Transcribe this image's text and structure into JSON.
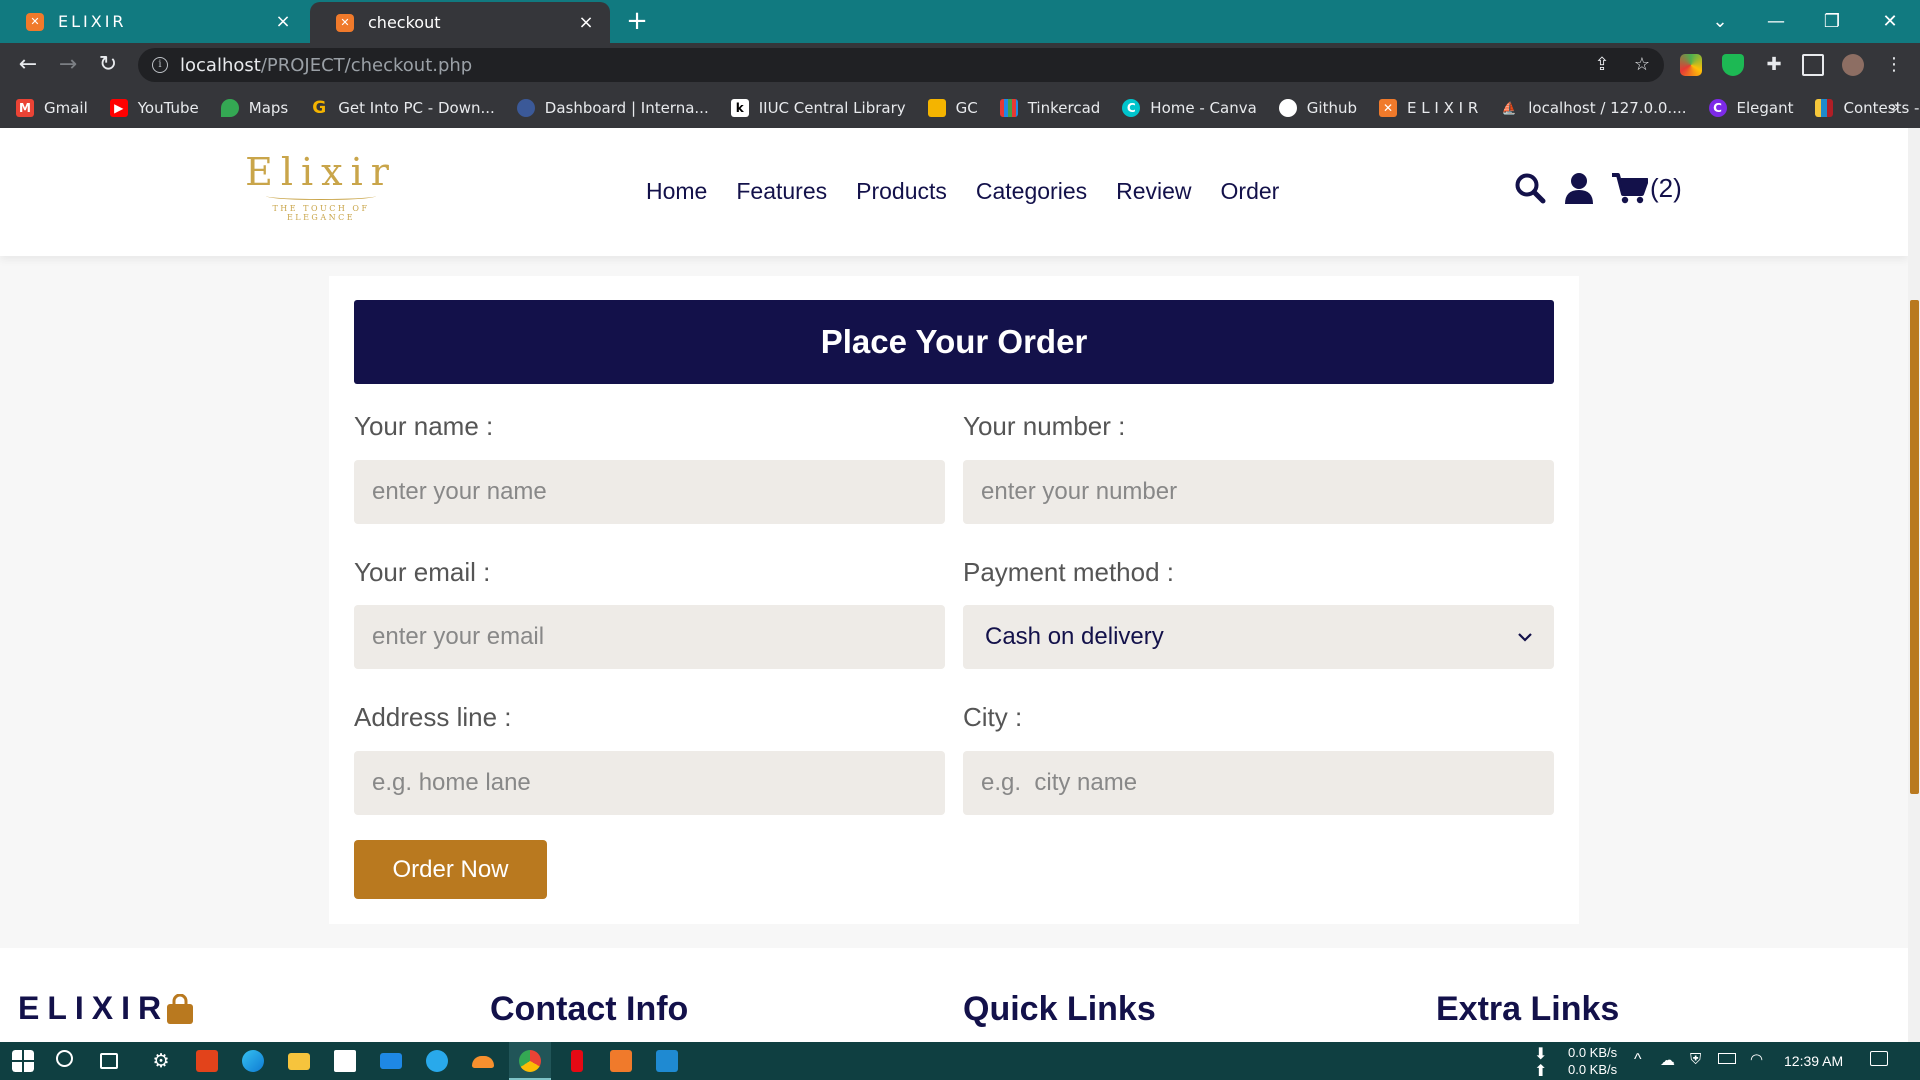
{
  "browser": {
    "tabs": [
      {
        "title": "ELIXIR",
        "favicon": "xampp-icon",
        "active": false
      },
      {
        "title": "checkout",
        "favicon": "xampp-icon",
        "active": true
      }
    ],
    "url_host": "localhost",
    "url_path": "/PROJECT/checkout.php",
    "bookmarks": [
      {
        "label": "Gmail",
        "icon": "gmail-icon",
        "color": "#ea4335"
      },
      {
        "label": "YouTube",
        "icon": "youtube-icon",
        "color": "#ff0000"
      },
      {
        "label": "Maps",
        "icon": "maps-icon",
        "color": "#34a853"
      },
      {
        "label": "Get Into PC - Down...",
        "icon": "getintopc-icon",
        "color": "#f4b400"
      },
      {
        "label": "Dashboard | Interna...",
        "icon": "dashboard-icon",
        "color": "#3b5998"
      },
      {
        "label": "IIUC Central Library",
        "icon": "library-icon",
        "color": "#ffffff"
      },
      {
        "label": "GC",
        "icon": "classroom-icon",
        "color": "#f4b400"
      },
      {
        "label": "Tinkercad",
        "icon": "tinkercad-icon",
        "color": "#1e88e5"
      },
      {
        "label": "Home - Canva",
        "icon": "canva-icon",
        "color": "#00c4cc"
      },
      {
        "label": "Github",
        "icon": "github-icon",
        "color": "#ffffff"
      },
      {
        "label": "E L I X I R",
        "icon": "xampp-icon",
        "color": "#f07a2b"
      },
      {
        "label": "localhost / 127.0.0....",
        "icon": "phpmyadmin-icon",
        "color": "#f6a21a"
      },
      {
        "label": "Elegant",
        "icon": "canva-icon",
        "color": "#7d2ae8"
      },
      {
        "label": "Contests - Codefor...",
        "icon": "codeforces-icon",
        "color": "#1f8acb"
      }
    ],
    "bookmarks_more": "»"
  },
  "site": {
    "logo_word": "Elixir",
    "logo_tagline": "THE TOUCH OF ELEGANCE",
    "nav": [
      "Home",
      "Features",
      "Products",
      "Categories",
      "Review",
      "Order"
    ],
    "cart_count": "(2)",
    "colors": {
      "navy": "#13114a",
      "gold": "#b9791f"
    }
  },
  "form": {
    "heading": "Place Your Order",
    "name_label": "Your name :",
    "name_placeholder": "enter your name",
    "number_label": "Your number :",
    "number_placeholder": "enter your number",
    "email_label": "Your email :",
    "email_placeholder": "enter your email",
    "payment_label": "Payment method :",
    "payment_selected": "Cash on delivery",
    "address_label": "Address line :",
    "address_placeholder": "e.g. home lane",
    "city_label": "City :",
    "city_placeholder": "e.g.  city name",
    "submit_label": "Order Now"
  },
  "footer": {
    "brand": "ELIXIR",
    "contact_title": "Contact Info",
    "quick_title": "Quick Links",
    "extra_title": "Extra Links"
  },
  "taskbar": {
    "net_down": "0.0 KB/s",
    "net_up": "0.0 KB/s",
    "time": "12:39 AM"
  }
}
